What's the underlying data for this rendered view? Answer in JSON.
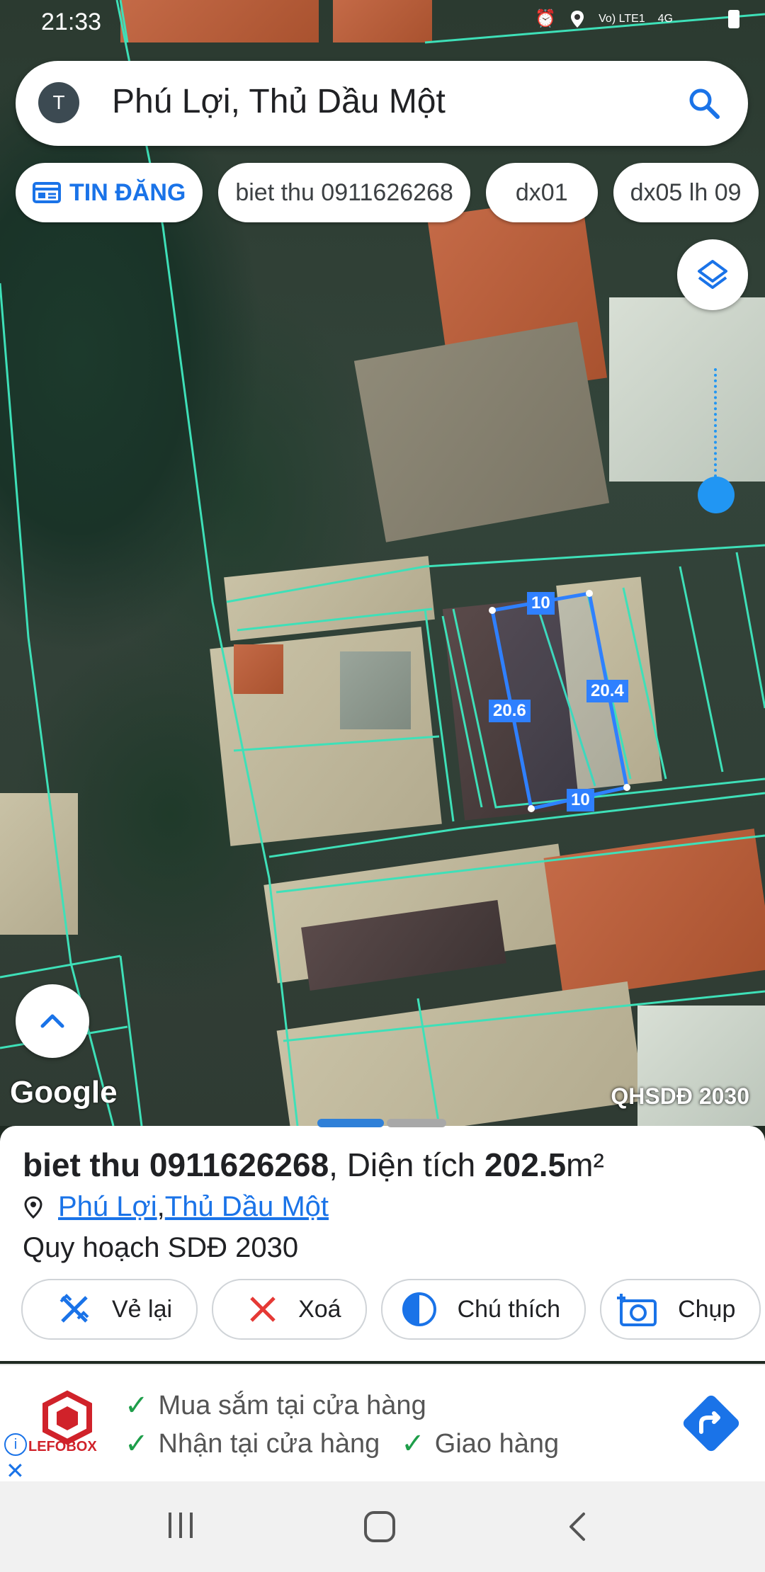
{
  "status": {
    "time": "21:33",
    "network": "Vo) LTE1",
    "signal": "4G"
  },
  "search": {
    "avatar_letter": "T",
    "query": "Phú Lợi, Thủ Dầu Một"
  },
  "chips": [
    {
      "label": "TIN ĐĂNG"
    },
    {
      "label": "biet thu 0911626268"
    },
    {
      "label": "dx01"
    },
    {
      "label": "dx05 lh 09"
    }
  ],
  "map": {
    "brand": "Google",
    "plan_label": "QHSDĐ 2030",
    "measurements": {
      "top": "10",
      "bottom": "10",
      "left": "20.6",
      "right": "20.4"
    }
  },
  "sheet": {
    "title_name": "biet thu 0911626268",
    "title_sep": ", Diện tích ",
    "area_value": "202.5",
    "area_unit": "m²",
    "location_ward": "Phú Lợi",
    "location_sep": ", ",
    "location_city": "Thủ Dầu Một",
    "plan": "Quy hoạch SDĐ 2030",
    "actions": [
      {
        "label": "Vẻ lại",
        "icon": "redraw-icon"
      },
      {
        "label": "Xoá",
        "icon": "close-icon"
      },
      {
        "label": "Chú thích",
        "icon": "legend-icon"
      },
      {
        "label": "Chụp",
        "icon": "camera-icon"
      }
    ]
  },
  "ad": {
    "brand": "LEFOBOX",
    "line1": "Mua sắm tại cửa hàng",
    "line2a": "Nhận tại cửa hàng",
    "line2b": "Giao hàng"
  },
  "colors": {
    "accent": "#1a73e8",
    "parcel_line": "#3ee0b8",
    "measure": "#2f80ff"
  }
}
